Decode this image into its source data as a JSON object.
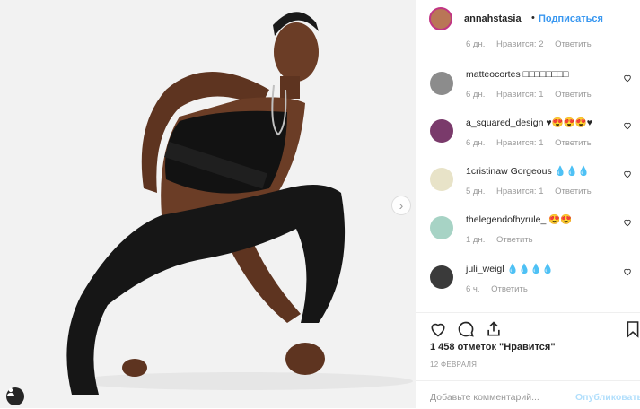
{
  "post": {
    "username": "annahstasia",
    "separator": "•",
    "follow_label": "Подписаться",
    "photo_label": "Woman in black sports top and leggings",
    "next_arrow": "›",
    "likes_text": "1 458 отметок \"Нравится\"",
    "date": "12 ФЕВРАЛЯ",
    "comment_placeholder": "Добавьте комментарий...",
    "publish_label": "Опубликовать"
  },
  "colors": {
    "link_blue": "#3897f0",
    "publish_disabled": "#b2dffc",
    "muted": "#999999",
    "text": "#262626"
  },
  "partial_meta": {
    "time": "6 дн.",
    "likes": "Нравится: 2",
    "reply": "Ответить"
  },
  "comments": [
    {
      "user": "matteocortes",
      "text": "□□□□□□□□",
      "time": "6 дн.",
      "likes": "Нравится: 1",
      "reply": "Ответить"
    },
    {
      "user": "a_squared_design",
      "text": "♥😍😍😍♥",
      "time": "6 дн.",
      "likes": "Нравится: 1",
      "reply": "Ответить"
    },
    {
      "user": "1cristinaw",
      "text": "Gorgeous 💧💧💧",
      "time": "5 дн.",
      "likes": "Нравится: 1",
      "reply": "Ответить"
    },
    {
      "user": "thelegendofhyrule_",
      "text": "😍😍",
      "time": "1 дн.",
      "reply": "Ответить"
    },
    {
      "user": "juli_weigl",
      "text": "💧💧💧💧",
      "time": "6 ч.",
      "reply": "Ответить"
    }
  ],
  "icons": [
    "heart-icon",
    "comment-icon",
    "share-icon",
    "bookmark-icon",
    "user-tag-icon"
  ]
}
